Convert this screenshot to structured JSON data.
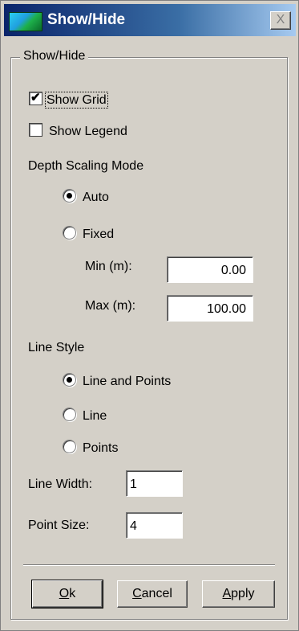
{
  "window": {
    "title": "Show/Hide",
    "close_label": "X"
  },
  "group": {
    "label": "Show/Hide"
  },
  "show_grid": {
    "label": "Show Grid",
    "checked": true
  },
  "show_legend": {
    "label": "Show Legend",
    "checked": false
  },
  "depth_scaling": {
    "heading": "Depth Scaling Mode",
    "options": [
      {
        "label": "Auto",
        "selected": true
      },
      {
        "label": "Fixed",
        "selected": false
      }
    ],
    "min_label": "Min (m):",
    "min_value": "0.00",
    "max_label": "Max (m):",
    "max_value": "100.00"
  },
  "line_style": {
    "heading": "Line Style",
    "options": [
      {
        "label": "Line and Points",
        "selected": true
      },
      {
        "label": "Line",
        "selected": false
      },
      {
        "label": "Points",
        "selected": false
      }
    ]
  },
  "line_width": {
    "label": "Line Width:",
    "value": "1"
  },
  "point_size": {
    "label": "Point Size:",
    "value": "4"
  },
  "buttons": {
    "ok": "Ok",
    "cancel": "Cancel",
    "apply": "Apply"
  }
}
